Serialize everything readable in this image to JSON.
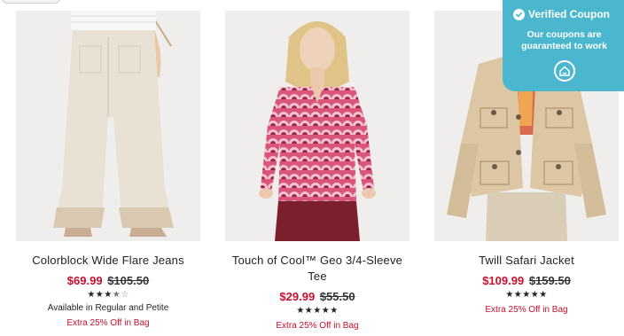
{
  "products": [
    {
      "name": "Colorblock Wide Flare Jeans",
      "sale_price": "$69.99",
      "original_price": "$105.50",
      "rating": 3.5,
      "stars_filled": "★★★",
      "stars_half": "★",
      "stars_empty": "☆",
      "availability": "Available in Regular and Petite",
      "promo": "Extra 25% Off in Bag",
      "image_icon": "flare-jeans-image"
    },
    {
      "name": "Touch of Cool™ Geo 3/4-Sleeve Tee",
      "sale_price": "$29.99",
      "original_price": "$55.50",
      "rating": 5,
      "stars_filled": "★★★★★",
      "promo": "Extra 25% Off in Bag",
      "image_icon": "geo-tee-image"
    },
    {
      "name": "Twill Safari Jacket",
      "sale_price": "$109.99",
      "original_price": "$159.50",
      "rating": 5,
      "stars_filled": "★★★★★",
      "promo": "Extra 25% Off in Bag",
      "image_icon": "safari-jacket-image"
    }
  ],
  "coupon_overlay": {
    "title": "Verified Coupon",
    "subtitle": "Our coupons are guaranteed to work",
    "check_icon": "check-circle-icon",
    "logo_icon": "coupon-logo-icon"
  },
  "colors": {
    "sale_red": "#c8102e",
    "coupon_teal": "#4ab7cf"
  }
}
